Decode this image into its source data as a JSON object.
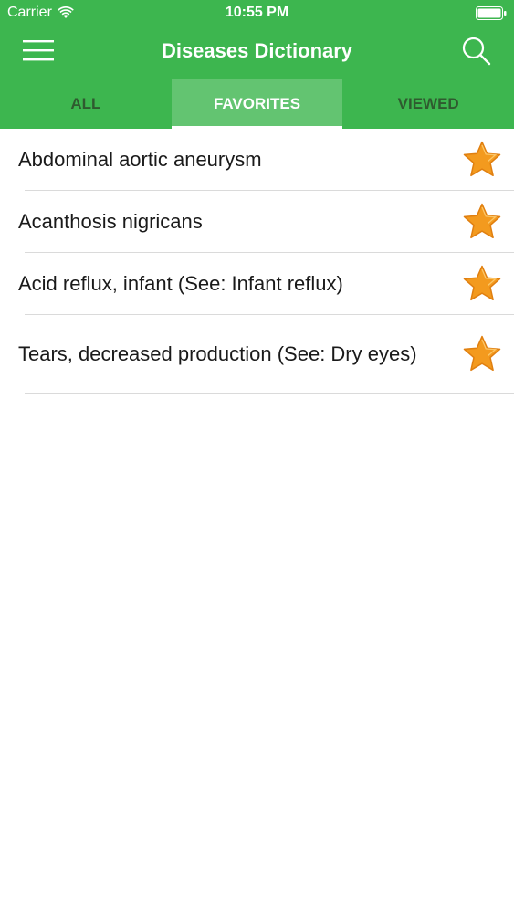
{
  "status_bar": {
    "carrier": "Carrier",
    "time": "10:55 PM"
  },
  "nav": {
    "title": "Diseases Dictionary",
    "menu_icon": "hamburger-menu-icon",
    "search_icon": "search-icon"
  },
  "tabs": [
    {
      "label": "ALL",
      "active": false
    },
    {
      "label": "FAVORITES",
      "active": true
    },
    {
      "label": "VIEWED",
      "active": false
    }
  ],
  "favorites": [
    {
      "label": "Abdominal aortic aneurysm",
      "starred": true
    },
    {
      "label": "Acanthosis nigricans",
      "starred": true
    },
    {
      "label": "Acid reflux, infant (See: Infant reflux)",
      "starred": true
    },
    {
      "label": "Tears, decreased production (See: Dry eyes)",
      "starred": true
    }
  ],
  "colors": {
    "header_green": "#3db64f",
    "active_tab": "#63c471",
    "star_orange": "#f39a1e"
  }
}
